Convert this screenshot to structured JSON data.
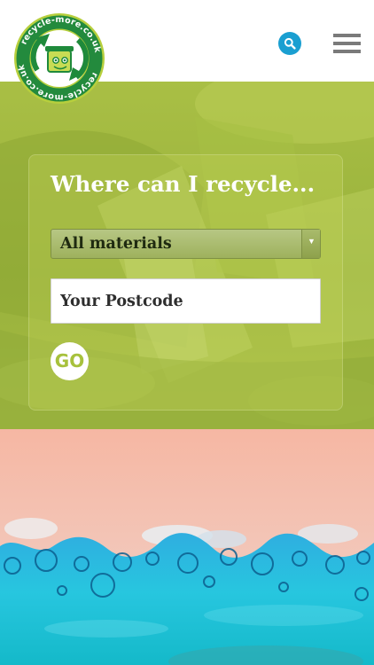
{
  "header": {
    "logo_text": "recycle-more.co.uk",
    "logo_icon": "recycle-bin-icon",
    "search_icon": "search-icon",
    "menu_icon": "hamburger-menu-icon"
  },
  "search": {
    "title": "Where can I recycle...",
    "material_selected": "All materials",
    "postcode_placeholder": "Your Postcode",
    "go_label": "GO"
  },
  "colors": {
    "brand_green": "#a7c13c",
    "search_blue": "#1a9fd1",
    "menu_grey": "#7a7a7a"
  }
}
